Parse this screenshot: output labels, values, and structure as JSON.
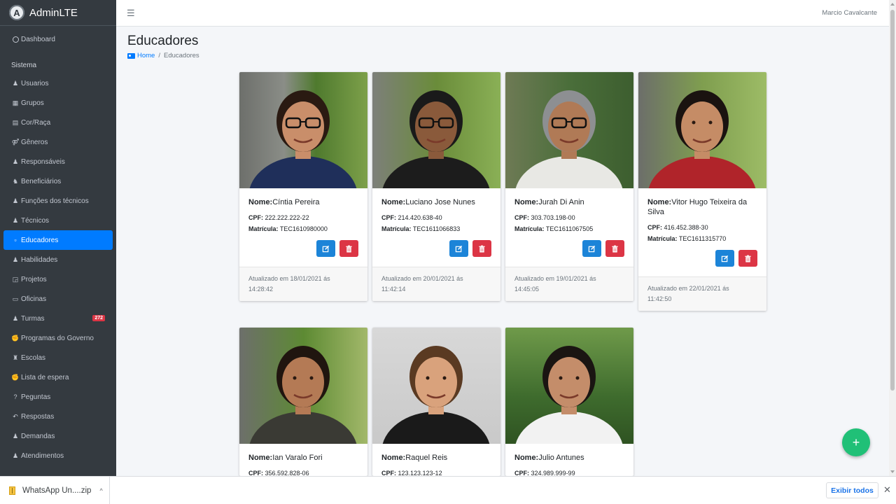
{
  "brand": {
    "name": "AdminLTE",
    "logo_letter": "A"
  },
  "topbar": {
    "menu_icon": "hamburger-icon",
    "user_name": "Marcio Cavalcante"
  },
  "sidebar": {
    "dashboard": "Dashboard",
    "section_header": "Sistema",
    "items": [
      {
        "label": "Usuarios",
        "icon": "user-icon"
      },
      {
        "label": "Grupos",
        "icon": "group-icon"
      },
      {
        "label": "Cor/Raça",
        "icon": "id-card-icon"
      },
      {
        "label": "Gêneros",
        "icon": "venus-mars-icon"
      },
      {
        "label": "Responsáveis",
        "icon": "users-icon"
      },
      {
        "label": "Beneficiários",
        "icon": "child-icon"
      },
      {
        "label": "Funções dos técnicos",
        "icon": "user-cog-icon"
      },
      {
        "label": "Técnicos",
        "icon": "user-tie-icon"
      },
      {
        "label": "Educadores",
        "icon": "chalkboard-teacher-icon",
        "active": true
      },
      {
        "label": "Habilidades",
        "icon": "user-graduate-icon"
      },
      {
        "label": "Projetos",
        "icon": "project-diagram-icon"
      },
      {
        "label": "Oficinas",
        "icon": "laptop-icon"
      },
      {
        "label": "Turmas",
        "icon": "users-class-icon",
        "badge": "272"
      },
      {
        "label": "Programas do Governo",
        "icon": "handshake-icon"
      },
      {
        "label": "Escolas",
        "icon": "school-icon"
      },
      {
        "label": "Lista de espera",
        "icon": "handshake-icon"
      },
      {
        "label": "Peguntas",
        "icon": "question-icon"
      },
      {
        "label": "Respostas",
        "icon": "reply-all-icon"
      },
      {
        "label": "Demandas",
        "icon": "user-icon"
      },
      {
        "label": "Atendimentos",
        "icon": "user-icon"
      }
    ],
    "badge_color": "#dc3545",
    "active_color": "#007bff"
  },
  "page": {
    "title": "Educadores",
    "breadcrumb": {
      "home": "Home",
      "separator": "/",
      "current": "Educadores"
    }
  },
  "labels": {
    "name": "Nome:",
    "cpf": "CPF:",
    "matricula": "Matrícula:"
  },
  "educators": [
    {
      "name": "Cíntia Pereira",
      "cpf": "222.222.222-22",
      "matricula": "TEC1610980000",
      "updated_line1": "Atualizado em 18/01/2021 ás",
      "updated_line2": "14:28:42"
    },
    {
      "name": "Luciano Jose Nunes",
      "cpf": "214.420.638-40",
      "matricula": "TEC1611066833",
      "updated_line1": "Atualizado em 20/01/2021 ás",
      "updated_line2": "11:42:14"
    },
    {
      "name": "Jurah Di Anin",
      "cpf": "303.703.198-00",
      "matricula": "TEC1611067505",
      "updated_line1": "Atualizado em 19/01/2021 ás",
      "updated_line2": "14:45:05"
    },
    {
      "name": "Vitor Hugo Teixeira da Silva",
      "cpf": "416.452.388-30",
      "matricula": "TEC1611315770",
      "updated_line1": "Atualizado em 22/01/2021 ás",
      "updated_line2": "11:42:50"
    },
    {
      "name": "Ian Varalo Fori",
      "cpf": "356.592.828-06"
    },
    {
      "name": "Raquel Reis",
      "cpf": "123.123.123-12"
    },
    {
      "name": "Julio Antunes",
      "cpf": "324.989.999-99"
    }
  ],
  "fab": {
    "symbol": "+",
    "color": "#20c077"
  },
  "download_bar": {
    "file_name": "WhatsApp Un....zip",
    "chevron": "^",
    "show_all": "Exibir todos",
    "close": "✕"
  },
  "colors": {
    "edit_button": "#1c84d8",
    "delete_button": "#dc3545",
    "sidebar_bg": "#343a40"
  }
}
